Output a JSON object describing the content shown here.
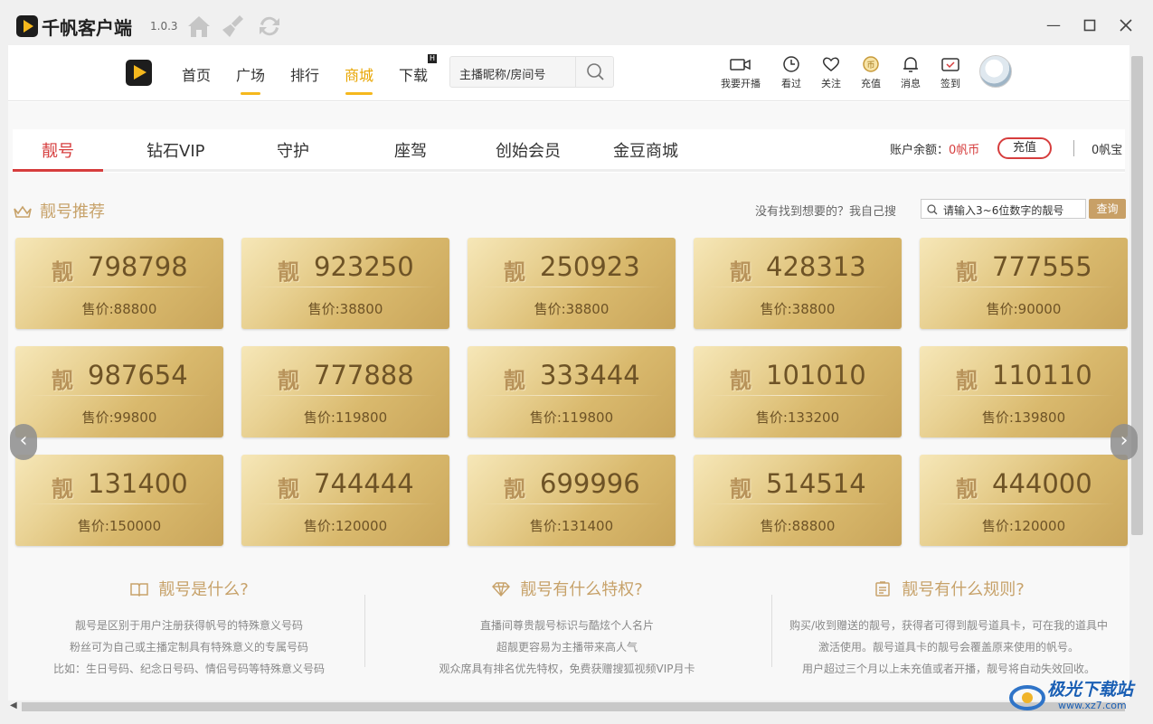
{
  "titlebar": {
    "app_name": "千帆客户端",
    "version": "1.0.3",
    "icons": [
      "home-icon",
      "broom-icon",
      "refresh-icon"
    ],
    "window_controls": [
      "minimize-icon",
      "maximize-icon",
      "close-icon"
    ]
  },
  "nav": {
    "items": [
      {
        "label": "首页"
      },
      {
        "label": "广场"
      },
      {
        "label": "排行"
      },
      {
        "label": "商城"
      },
      {
        "label": "下载"
      }
    ],
    "new_badge": "H",
    "search_placeholder": "主播昵称/房间号",
    "tools": [
      {
        "label": "我要开播",
        "icon": "camera-icon"
      },
      {
        "label": "看过",
        "icon": "clock-icon"
      },
      {
        "label": "关注",
        "icon": "heart-icon"
      },
      {
        "label": "充值",
        "icon": "coin-icon"
      },
      {
        "label": "消息",
        "icon": "bell-icon"
      },
      {
        "label": "签到",
        "icon": "calendar-check-icon"
      }
    ]
  },
  "tabs": [
    "靓号",
    "钻石VIP",
    "守护",
    "座驾",
    "创始会员",
    "金豆商城"
  ],
  "account": {
    "balance_label": "账户余额：",
    "balance_value": "0帆币",
    "recharge_button": "充值",
    "fanbao": "0帆宝"
  },
  "section": {
    "title": "靓号推荐",
    "hint": "没有找到想要的？我自己搜",
    "query_placeholder": "请输入3~6位数字的靓号",
    "query_button": "查询"
  },
  "card_mark": "靓",
  "cards": [
    {
      "number": "798798",
      "price": "售价:88800"
    },
    {
      "number": "923250",
      "price": "售价:38800"
    },
    {
      "number": "250923",
      "price": "售价:38800"
    },
    {
      "number": "428313",
      "price": "售价:38800"
    },
    {
      "number": "777555",
      "price": "售价:90000"
    },
    {
      "number": "987654",
      "price": "售价:99800"
    },
    {
      "number": "777888",
      "price": "售价:119800"
    },
    {
      "number": "333444",
      "price": "售价:119800"
    },
    {
      "number": "101010",
      "price": "售价:133200"
    },
    {
      "number": "110110",
      "price": "售价:139800"
    },
    {
      "number": "131400",
      "price": "售价:150000"
    },
    {
      "number": "744444",
      "price": "售价:120000"
    },
    {
      "number": "699996",
      "price": "售价:131400"
    },
    {
      "number": "514514",
      "price": "售价:88800"
    },
    {
      "number": "444000",
      "price": "售价:120000"
    }
  ],
  "info": [
    {
      "title": "靓号是什么?",
      "icon": "book-icon",
      "lines": [
        "靓号是区别于用户注册获得帆号的特殊意义号码",
        "粉丝可为自己或主播定制具有特殊意义的专属号码",
        "比如：生日号码、纪念日号码、情侣号码等特殊意义号码"
      ]
    },
    {
      "title": "靓号有什么特权?",
      "icon": "diamond-icon",
      "lines": [
        "直播间尊贵靓号标识与酷炫个人名片",
        "超靓更容易为主播带来高人气",
        "观众席具有排名优先特权，免费获赠搜狐视频VIP月卡"
      ]
    },
    {
      "title": "靓号有什么规则?",
      "icon": "document-icon",
      "lines": [
        "购买/收到赠送的靓号，获得者可得到靓号道具卡，可在我的道具中",
        "激活使用。靓号道具卡的靓号会覆盖原来使用的帆号。",
        "用户超过三个月以上未充值或者开播，靓号将自动失效回收。"
      ]
    }
  ],
  "watermark": {
    "text": "极光下载站",
    "url": "www.xz7.com"
  }
}
